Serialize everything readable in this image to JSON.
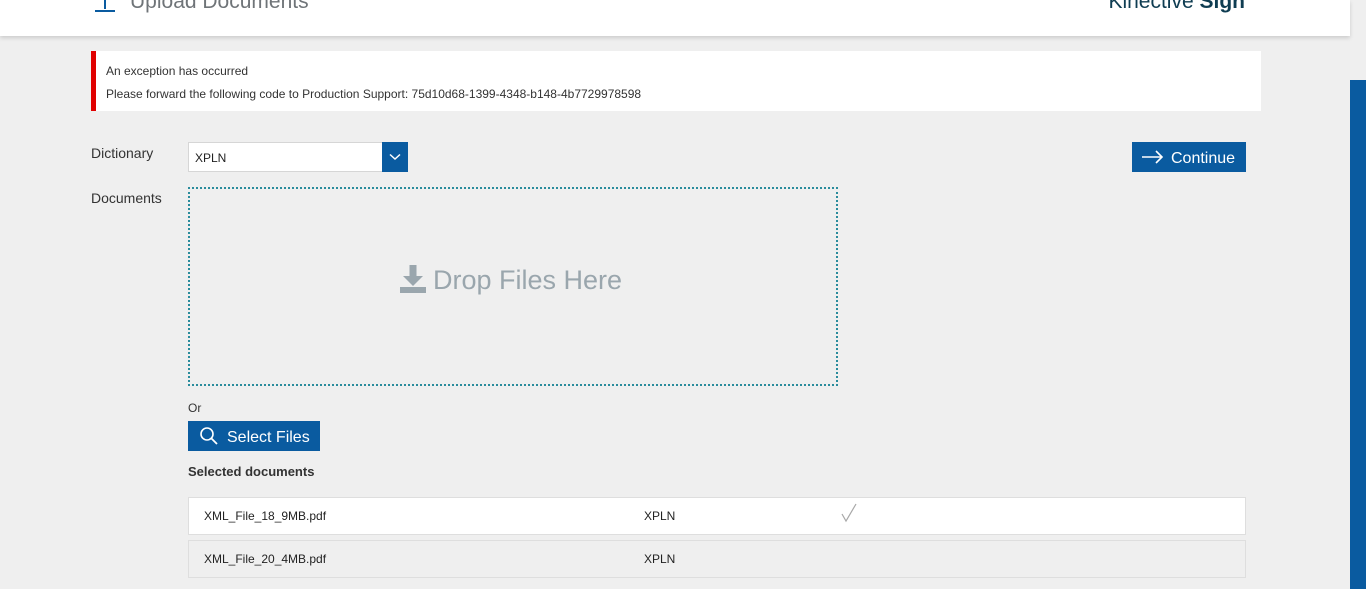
{
  "header": {
    "title": "Upload Documents",
    "brand_light": "Kinective",
    "brand_bold": "Sign",
    "icon": "upload-icon"
  },
  "error": {
    "line1": "An exception has occurred",
    "line2": "Please forward the following code to Production Support: 75d10d68-1399-4348-b148-4b7729978598"
  },
  "form": {
    "dictionary_label": "Dictionary",
    "dictionary_value": "XPLN",
    "documents_label": "Documents",
    "continue_label": "Continue",
    "dropzone_text": "Drop Files Here",
    "or_text": "Or",
    "select_files_label": "Select Files"
  },
  "selected": {
    "title": "Selected documents",
    "rows": [
      {
        "name": "XML_File_18_9MB.pdf",
        "dictionary": "XPLN",
        "status": "check-icon"
      },
      {
        "name": "XML_File_20_4MB.pdf",
        "dictionary": "XPLN",
        "status": ""
      }
    ]
  },
  "colors": {
    "primary": "#0a5ba0",
    "error": "#e00000",
    "dropzone_border": "#2a8c9c",
    "background": "#efefef"
  }
}
